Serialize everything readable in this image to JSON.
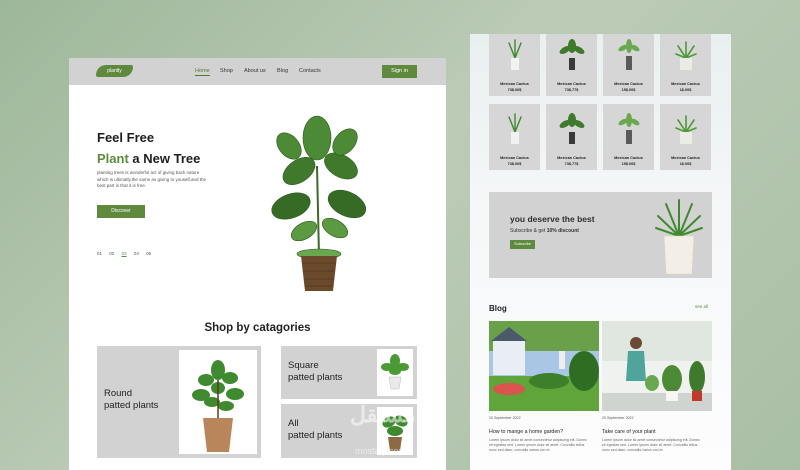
{
  "left_page": {
    "nav": {
      "logo": "plantly",
      "links": [
        "Home",
        "Shop",
        "About us",
        "Blog",
        "Contacts"
      ],
      "active": "Home",
      "signin": "Sign in"
    },
    "hero": {
      "line1": "Feel Free",
      "line2_green": "Plant",
      "line2_rest": " a New Tree",
      "description": "planting trees is wonderful act of giving back nature which is ultimatly,the same as giving to youself,and the best part is that it is free.",
      "button": "Discover",
      "pager": [
        "01",
        "02",
        "03",
        "04",
        "05"
      ],
      "pager_active": "03"
    },
    "categories": {
      "title": "Shop by catagories",
      "items": [
        {
          "line1": "Round",
          "line2": "patted plants"
        },
        {
          "line1": "Square",
          "line2": "patted plants"
        },
        {
          "line1": "All",
          "line2": "patted plants"
        }
      ]
    }
  },
  "right_page": {
    "products_row1": [
      {
        "name": "Mexican Cactus",
        "price": "73$.00$"
      },
      {
        "name": "Mexican Cactus",
        "price": "73$.77$"
      },
      {
        "name": "Mexican Cactus",
        "price": "15$.00$"
      },
      {
        "name": "Mexican Cactus",
        "price": "1$.00$"
      }
    ],
    "products_row2": [
      {
        "name": "Mexican Cactus",
        "price": "73$.00$"
      },
      {
        "name": "Mexican Cactus",
        "price": "73$.77$"
      },
      {
        "name": "Mexican Cactus",
        "price": "15$.00$"
      },
      {
        "name": "Mexican Cactus",
        "price": "1$.00$"
      }
    ],
    "promo": {
      "title": "you deserve the best",
      "subtitle_pre": "Subscribe & get ",
      "subtitle_bold": "10% discount",
      "button": "Subscribe"
    },
    "blog": {
      "title": "Blog",
      "see_all": "see all",
      "posts": [
        {
          "date": "20 September 2022",
          "title": "How to mange a home garden?",
          "text": "Lorem ipsum dolor sit amet consectetur adipiscing elit. Donec sit egestas sed. Lorem ipsum dolor sit amet. Convallis tellus nunc sed diam, convallis varius orci et."
        },
        {
          "date": "20 September 2022",
          "title": "Take care of your plant",
          "text": "Lorem ipsum dolor sit amet consectetur adipiscing elit. Donec sit egestas sed. Lorem ipsum dolor sit amet. Convallis tellus nunc sed diam, convallis varius orci et."
        }
      ]
    }
  },
  "watermark": {
    "arabic": "مستقل",
    "latin": "mostaql.com"
  },
  "colors": {
    "accent": "#5f8a3e",
    "card": "#d2d2d2",
    "background": "#a9bfa5"
  }
}
